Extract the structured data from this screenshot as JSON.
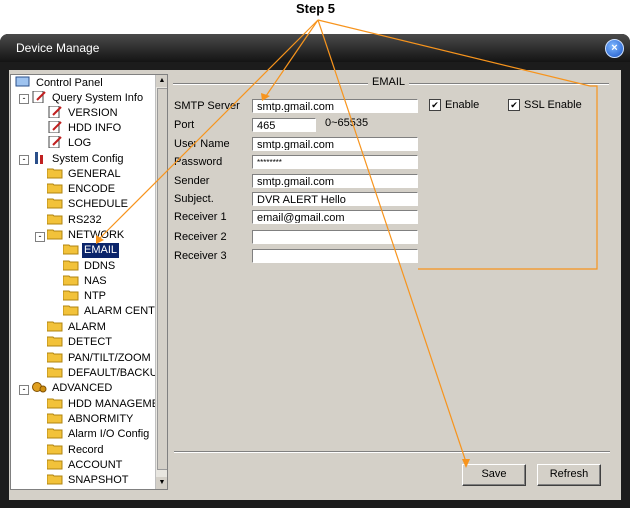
{
  "annotation": {
    "step_label": "Step 5",
    "color": "#f7941d"
  },
  "window": {
    "title": "Device Manage",
    "close_glyph": "×"
  },
  "tree": {
    "control_panel": "Control Panel",
    "query_system_info": "Query System Info",
    "version": "VERSION",
    "hdd_info": "HDD INFO",
    "log": "LOG",
    "system_config": "System Config",
    "general": "GENERAL",
    "encode": "ENCODE",
    "schedule": "SCHEDULE",
    "rs232": "RS232",
    "network": "NETWORK",
    "email": "EMAIL",
    "ddns": "DDNS",
    "nas": "NAS",
    "ntp": "NTP",
    "alarm_center": "ALARM CENTE",
    "alarm": "ALARM",
    "detect": "DETECT",
    "pan_tilt_zoom": "PAN/TILT/ZOOM",
    "default_backup": "DEFAULT/BACKUP",
    "advanced": "ADVANCED",
    "hdd_management": "HDD MANAGEMEI",
    "abnormity": "ABNORMITY",
    "alarm_io_config": "Alarm I/O Config",
    "record": "Record",
    "account": "ACCOUNT",
    "snapshot": "SNAPSHOT"
  },
  "email_form": {
    "group_title": "EMAIL",
    "smtp_server_label": "SMTP Server",
    "smtp_server_value": "smtp.gmail.com",
    "port_label": "Port",
    "port_value": "465",
    "port_range": "0~65535",
    "username_label": "User Name",
    "username_value": "smtp.gmail.com",
    "password_label": "Password",
    "password_value": "********",
    "sender_label": "Sender",
    "sender_value": "smtp.gmail.com",
    "subject_label": "Subject.",
    "subject_value": "DVR ALERT  Hello",
    "receiver1_label": "Receiver 1",
    "receiver1_value": "email@gmail.com",
    "receiver2_label": "Receiver 2",
    "receiver2_value": "",
    "receiver3_label": "Receiver 3",
    "receiver3_value": "",
    "enable_label": "Enable",
    "enable_checked": true,
    "ssl_label": "SSL Enable",
    "ssl_checked": true,
    "check_glyph": "✔"
  },
  "buttons": {
    "save": "Save",
    "refresh": "Refresh"
  }
}
